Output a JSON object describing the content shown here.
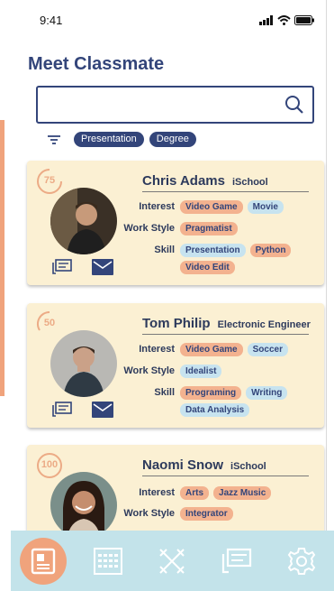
{
  "status": {
    "time": "9:41"
  },
  "page_title": "Meet Classmate",
  "search": {
    "value": "",
    "placeholder": ""
  },
  "filters": [
    "Presentation",
    "Degree"
  ],
  "labels": {
    "interest": "Interest",
    "work_style": "Work Style",
    "skill": "Skill"
  },
  "cards": [
    {
      "score": "75",
      "name": "Chris Adams",
      "org": "iSchool",
      "interests": [
        {
          "t": "Video Game",
          "c": "o"
        },
        {
          "t": "Movie",
          "c": "b"
        }
      ],
      "work_style": [
        {
          "t": "Pragmatist",
          "c": "o"
        }
      ],
      "skills": [
        {
          "t": "Presentation",
          "c": "b"
        },
        {
          "t": "Python",
          "c": "o"
        },
        {
          "t": "Video Edit",
          "c": "o"
        }
      ]
    },
    {
      "score": "50",
      "name": "Tom Philip",
      "org": "Electronic Engineer",
      "interests": [
        {
          "t": "Video Game",
          "c": "o"
        },
        {
          "t": "Soccer",
          "c": "b"
        }
      ],
      "work_style": [
        {
          "t": "Idealist",
          "c": "b"
        }
      ],
      "skills": [
        {
          "t": "Programing",
          "c": "o"
        },
        {
          "t": "Writing",
          "c": "b"
        },
        {
          "t": "Data Analysis",
          "c": "b"
        }
      ]
    },
    {
      "score": "100",
      "name": "Naomi Snow",
      "org": "iSchool",
      "interests": [
        {
          "t": "Arts",
          "c": "o"
        },
        {
          "t": "Jazz Music",
          "c": "o"
        }
      ],
      "work_style": [
        {
          "t": "Integrator",
          "c": "o"
        }
      ],
      "skills": []
    }
  ],
  "nav": [
    "profile-card-icon",
    "calendar-icon",
    "match-icon",
    "chat-icon",
    "settings-gear-icon"
  ],
  "colors": {
    "accent": "#33457a",
    "card": "#fbf0d3",
    "orange_tag": "#f3b28f",
    "blue_tag": "#c7e3ef",
    "nav_bg": "#c3e3ea",
    "active": "#f0a37c"
  }
}
